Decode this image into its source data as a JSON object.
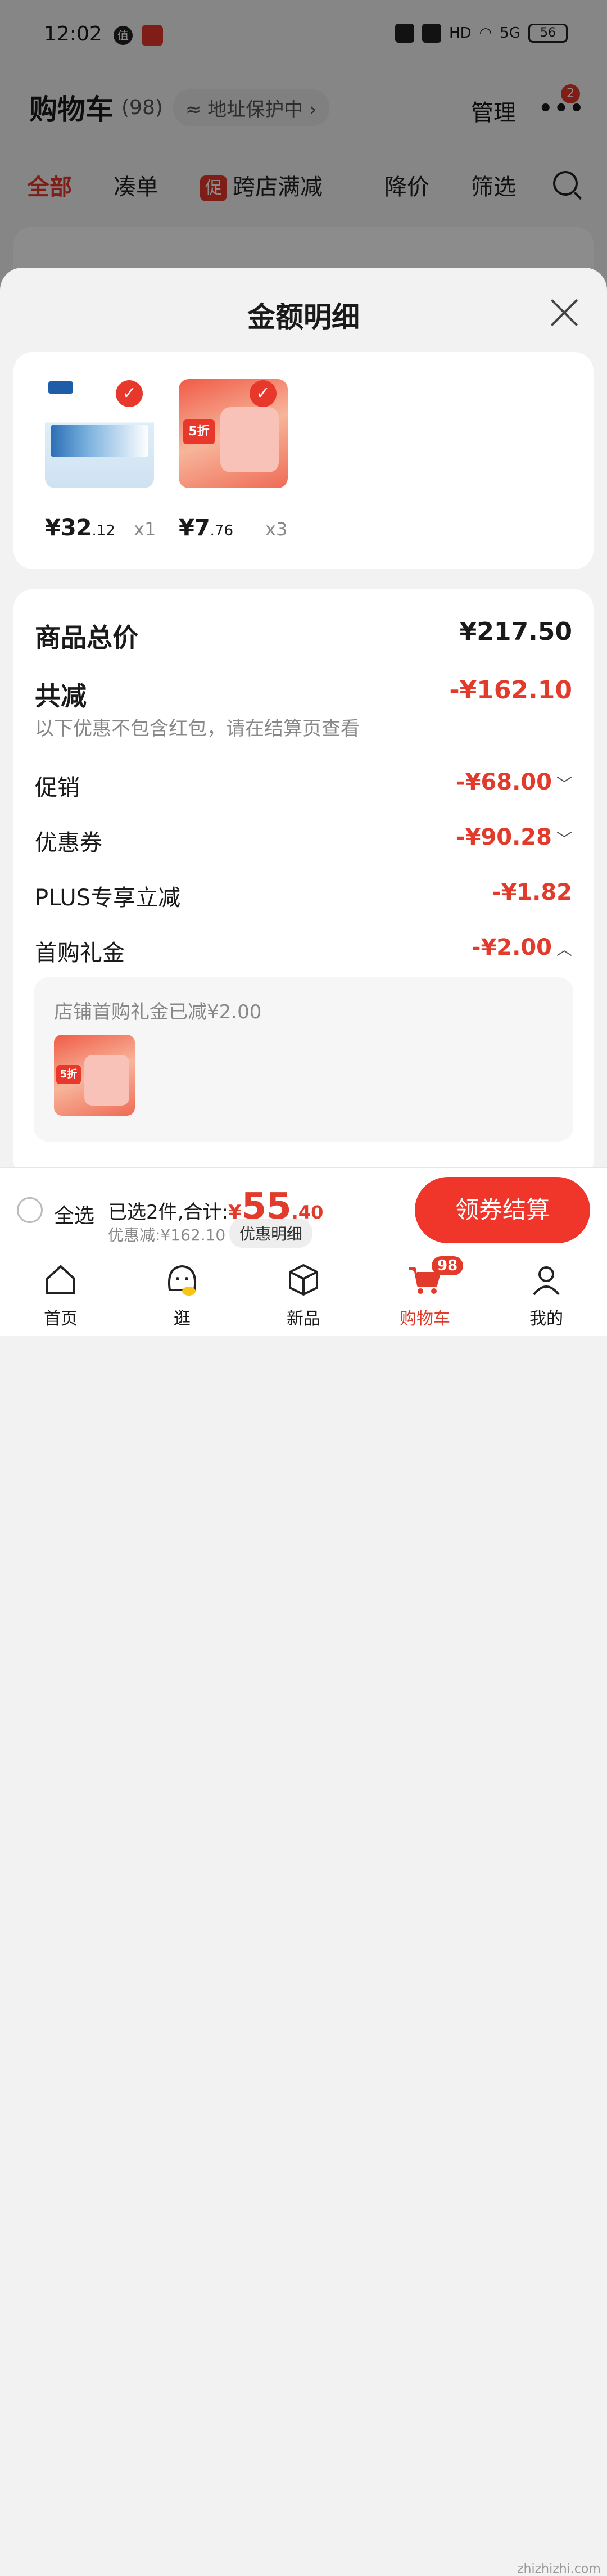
{
  "status_bar": {
    "time": "12:02",
    "battery": "56",
    "network": "5G",
    "hd": "HD"
  },
  "cart": {
    "title": "购物车",
    "count": "(98)",
    "address_protect": "≈ 地址保护中 ›",
    "manage": "管理",
    "more_badge": "2"
  },
  "tabs": [
    {
      "label": "全部",
      "active": true
    },
    {
      "label": "凑单"
    },
    {
      "label": "跨店满减",
      "tag": "促"
    },
    {
      "label": "降价"
    },
    {
      "label": "筛选"
    }
  ],
  "sheet": {
    "title": "金额明细",
    "products": [
      {
        "price_main": "¥32",
        "price_dec": ".12",
        "qty": "x1",
        "image": "milk-box-image",
        "checked": true
      },
      {
        "price_main": "¥7",
        "price_dec": ".76",
        "qty": "x3",
        "image": "liby-laundry-pods-image",
        "promo": "5折",
        "checked": true
      }
    ],
    "rows": {
      "total_label": "商品总价",
      "total_value": "¥217.50",
      "reduce_label": "共减",
      "reduce_value": "-¥162.10",
      "reduce_note": "以下优惠不包含红包，请在结算页查看",
      "promo_label": "促销",
      "promo_value": "-¥68.00",
      "coupon_label": "优惠券",
      "coupon_value": "-¥90.28",
      "plus_label": "PLUS专享立减",
      "plus_value": "-¥1.82",
      "gift_label": "首购礼金",
      "gift_value": "-¥2.00"
    },
    "gift_box": {
      "text": "店铺首购礼金已减¥2.00"
    }
  },
  "checkout": {
    "select_all": "全选",
    "summary_prefix": "已选2件,合计:",
    "total_currency": "¥",
    "total_main": "55",
    "total_dec": ".40",
    "saving": "优惠减:¥162.10",
    "detail_button": "优惠明细",
    "submit": "领券结算"
  },
  "nav": [
    {
      "label": "首页",
      "icon": "home-icon"
    },
    {
      "label": "逛",
      "icon": "explore-icon"
    },
    {
      "label": "新品",
      "icon": "cube-icon"
    },
    {
      "label": "购物车",
      "icon": "cart-icon",
      "badge": "98",
      "active": true
    },
    {
      "label": "我的",
      "icon": "user-icon"
    }
  ],
  "colors": {
    "accent": "#e23a2b",
    "button": "#f0352a",
    "sheet_bg": "#f2f2f2"
  },
  "watermark": "zhizhizhi.com"
}
